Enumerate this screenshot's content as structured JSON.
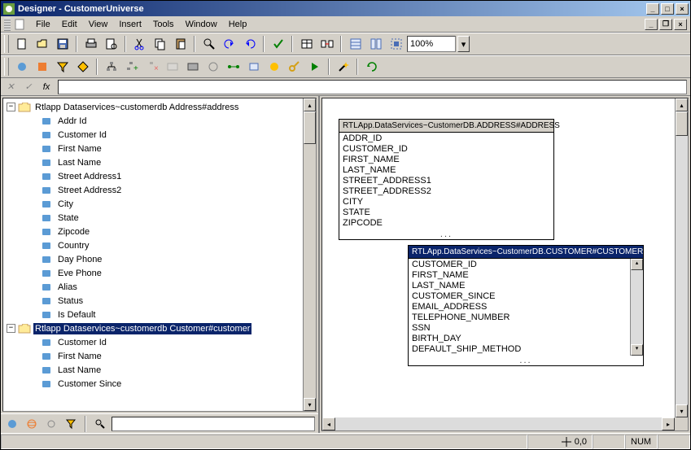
{
  "window": {
    "title": "Designer - CustomerUniverse"
  },
  "menus": [
    "File",
    "Edit",
    "View",
    "Insert",
    "Tools",
    "Window",
    "Help"
  ],
  "zoom": "100%",
  "formula_label": "fx",
  "tree": {
    "group1": {
      "label": "Rtlapp Dataservices~customerdb Address#address",
      "expanded": true,
      "children": [
        "Addr Id",
        "Customer Id",
        "First Name",
        "Last Name",
        "Street Address1",
        "Street Address2",
        "City",
        "State",
        "Zipcode",
        "Country",
        "Day Phone",
        "Eve Phone",
        "Alias",
        "Status",
        "Is Default"
      ]
    },
    "group2": {
      "label": "Rtlapp Dataservices~customerdb Customer#customer",
      "expanded": true,
      "selected": true,
      "children": [
        "Customer Id",
        "First Name",
        "Last Name",
        "Customer Since"
      ]
    }
  },
  "erd": {
    "address": {
      "title": "RTLApp.DataServices~CustomerDB.ADDRESS#ADDRESS",
      "fields": [
        "ADDR_ID",
        "CUSTOMER_ID",
        "FIRST_NAME",
        "LAST_NAME",
        "STREET_ADDRESS1",
        "STREET_ADDRESS2",
        "CITY",
        "STATE",
        "ZIPCODE"
      ]
    },
    "customer": {
      "title": "RTLApp.DataServices~CustomerDB.CUSTOMER#CUSTOMER",
      "fields": [
        "CUSTOMER_ID",
        "FIRST_NAME",
        "LAST_NAME",
        "CUSTOMER_SINCE",
        "EMAIL_ADDRESS",
        "TELEPHONE_NUMBER",
        "SSN",
        "BIRTH_DAY",
        "DEFAULT_SHIP_METHOD"
      ]
    }
  },
  "status": {
    "coords": "0,0",
    "mode": "NUM"
  }
}
